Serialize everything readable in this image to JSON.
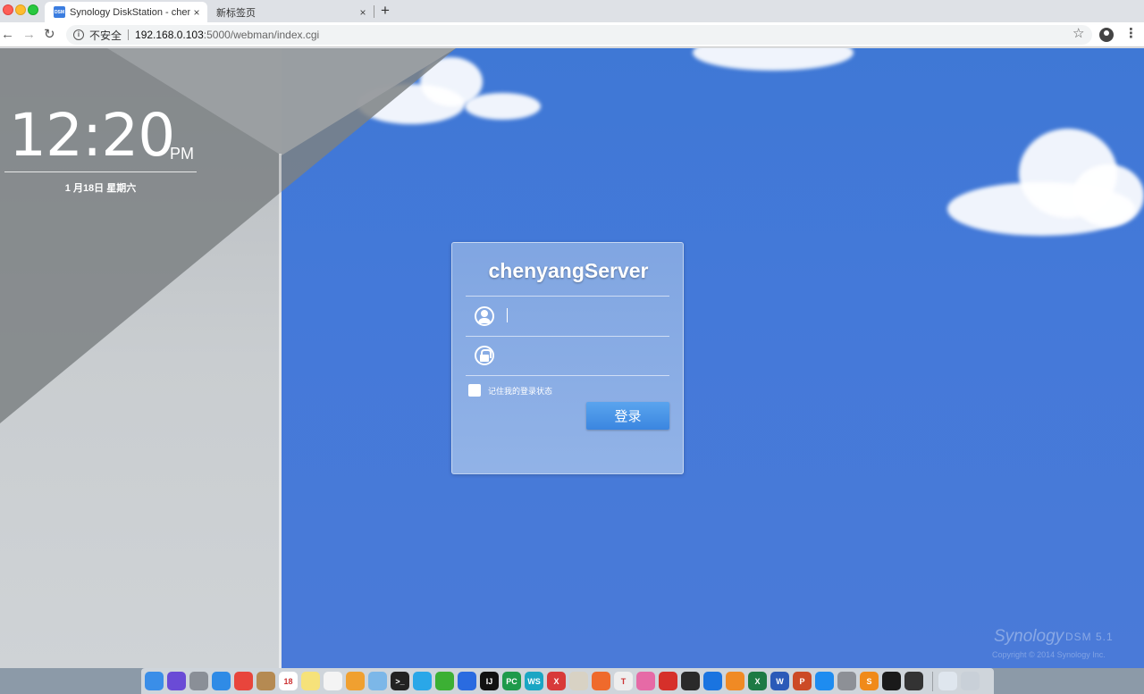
{
  "browser": {
    "tabs": [
      {
        "title": "Synology DiskStation - chenyangServer",
        "favicon": "DSM",
        "active": true
      },
      {
        "title": "新标签页",
        "active": false
      }
    ],
    "close_glyph": "×",
    "new_tab_glyph": "+",
    "security_label": "不安全",
    "url_host": "192.168.0.103",
    "url_path": ":5000/webman/index.cgi"
  },
  "clock": {
    "time": "12:20",
    "ampm": "PM",
    "date": "1 月18日 星期六"
  },
  "login": {
    "server_name": "chenyangServer",
    "username_value": "",
    "password_value": "",
    "remember_label": "记住我的登录状态",
    "remember_checked": false,
    "submit_label": "登录"
  },
  "footer": {
    "brand": "Synology",
    "product": "DSM 5.1",
    "copyright": "Copyright © 2014 Synology Inc."
  },
  "dock": {
    "items": [
      {
        "name": "finder-icon",
        "color": "#3a8ee8",
        "glyph": ""
      },
      {
        "name": "siri-icon",
        "color": "#6a4bd6",
        "glyph": ""
      },
      {
        "name": "launchpad-icon",
        "color": "#8a8f97",
        "glyph": ""
      },
      {
        "name": "safari-icon",
        "color": "#2f8be6",
        "glyph": ""
      },
      {
        "name": "chrome-icon",
        "color": "#e8453c",
        "glyph": ""
      },
      {
        "name": "contacts-icon",
        "color": "#b58a52",
        "glyph": ""
      },
      {
        "name": "calendar-icon",
        "color": "#ffffff",
        "glyph": "18"
      },
      {
        "name": "notes-icon",
        "color": "#f6e27a",
        "glyph": ""
      },
      {
        "name": "reminders-icon",
        "color": "#f4f4f4",
        "glyph": ""
      },
      {
        "name": "photos-icon",
        "color": "#f0a030",
        "glyph": ""
      },
      {
        "name": "preview-icon",
        "color": "#7cb7e8",
        "glyph": ""
      },
      {
        "name": "terminal-icon",
        "color": "#222222",
        "glyph": ">_"
      },
      {
        "name": "qq-icon",
        "color": "#2aa7e8",
        "glyph": ""
      },
      {
        "name": "wechat-icon",
        "color": "#3cb034",
        "glyph": ""
      },
      {
        "name": "vpn-icon",
        "color": "#2a6be0",
        "glyph": ""
      },
      {
        "name": "intellij-icon",
        "color": "#111111",
        "glyph": "IJ"
      },
      {
        "name": "pycharm-icon",
        "color": "#1e9a4a",
        "glyph": "PC"
      },
      {
        "name": "webstorm-icon",
        "color": "#1aa6c4",
        "glyph": "WS"
      },
      {
        "name": "xmind-icon",
        "color": "#d83a3a",
        "glyph": "X"
      },
      {
        "name": "font-icon",
        "color": "#d8d2c4",
        "glyph": ""
      },
      {
        "name": "swift-icon",
        "color": "#ef6a2c",
        "glyph": ""
      },
      {
        "name": "typora-icon",
        "color": "#eeeeee",
        "glyph": "T"
      },
      {
        "name": "pinwheel-icon",
        "color": "#e66aa6",
        "glyph": ""
      },
      {
        "name": "netease-music-icon",
        "color": "#d6302a",
        "glyph": ""
      },
      {
        "name": "activity-monitor-icon",
        "color": "#2a2a2a",
        "glyph": ""
      },
      {
        "name": "teamviewer-icon",
        "color": "#1a74e0",
        "glyph": ""
      },
      {
        "name": "books-icon",
        "color": "#f08a24",
        "glyph": ""
      },
      {
        "name": "excel-icon",
        "color": "#1d7a44",
        "glyph": "X"
      },
      {
        "name": "word-icon",
        "color": "#2b5ab8",
        "glyph": "W"
      },
      {
        "name": "powerpoint-icon",
        "color": "#cc4a26",
        "glyph": "P"
      },
      {
        "name": "app-store-icon",
        "color": "#1e8cf0",
        "glyph": ""
      },
      {
        "name": "system-preferences-icon",
        "color": "#8d9096",
        "glyph": ""
      },
      {
        "name": "sublime-text-icon",
        "color": "#f08a1a",
        "glyph": "S"
      },
      {
        "name": "quicktime-icon",
        "color": "#1a1a1a",
        "glyph": ""
      },
      {
        "name": "console-icon",
        "color": "#333333",
        "glyph": ""
      }
    ],
    "trailing": [
      {
        "name": "documents-folder-icon",
        "color": "#dfe6ee",
        "glyph": ""
      },
      {
        "name": "trash-icon",
        "color": "#c9d0d8",
        "glyph": ""
      }
    ]
  }
}
